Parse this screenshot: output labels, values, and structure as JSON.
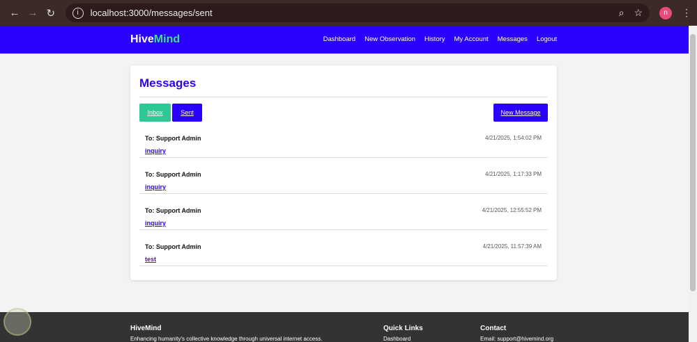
{
  "browser": {
    "url": "localhost:3000/messages/sent",
    "avatar": "n"
  },
  "nav": {
    "logo_a": "Hive",
    "logo_b": "Mind",
    "links": [
      "Dashboard",
      "New Observation",
      "History",
      "My Account",
      "Messages",
      "Logout"
    ]
  },
  "page": {
    "title": "Messages",
    "inbox": "Inbox",
    "sent": "Sent",
    "new_message": "New Message"
  },
  "messages": [
    {
      "to": "To: Support Admin",
      "time": "4/21/2025, 1:54:02 PM",
      "subject": "inquiry"
    },
    {
      "to": "To: Support Admin",
      "time": "4/21/2025, 1:17:33 PM",
      "subject": "inquiry"
    },
    {
      "to": "To: Support Admin",
      "time": "4/21/2025, 12:55:52 PM",
      "subject": "inquiry"
    },
    {
      "to": "To: Support Admin",
      "time": "4/21/2025, 11:57:39 AM",
      "subject": "test"
    }
  ],
  "footer": {
    "brand": "HiveMind",
    "tagline": "Enhancing humanity's collective knowledge through universal internet access.",
    "quick_title": "Quick Links",
    "quick_first": "Dashboard",
    "contact_title": "Contact",
    "email": "Email: support@hivemind.org"
  }
}
